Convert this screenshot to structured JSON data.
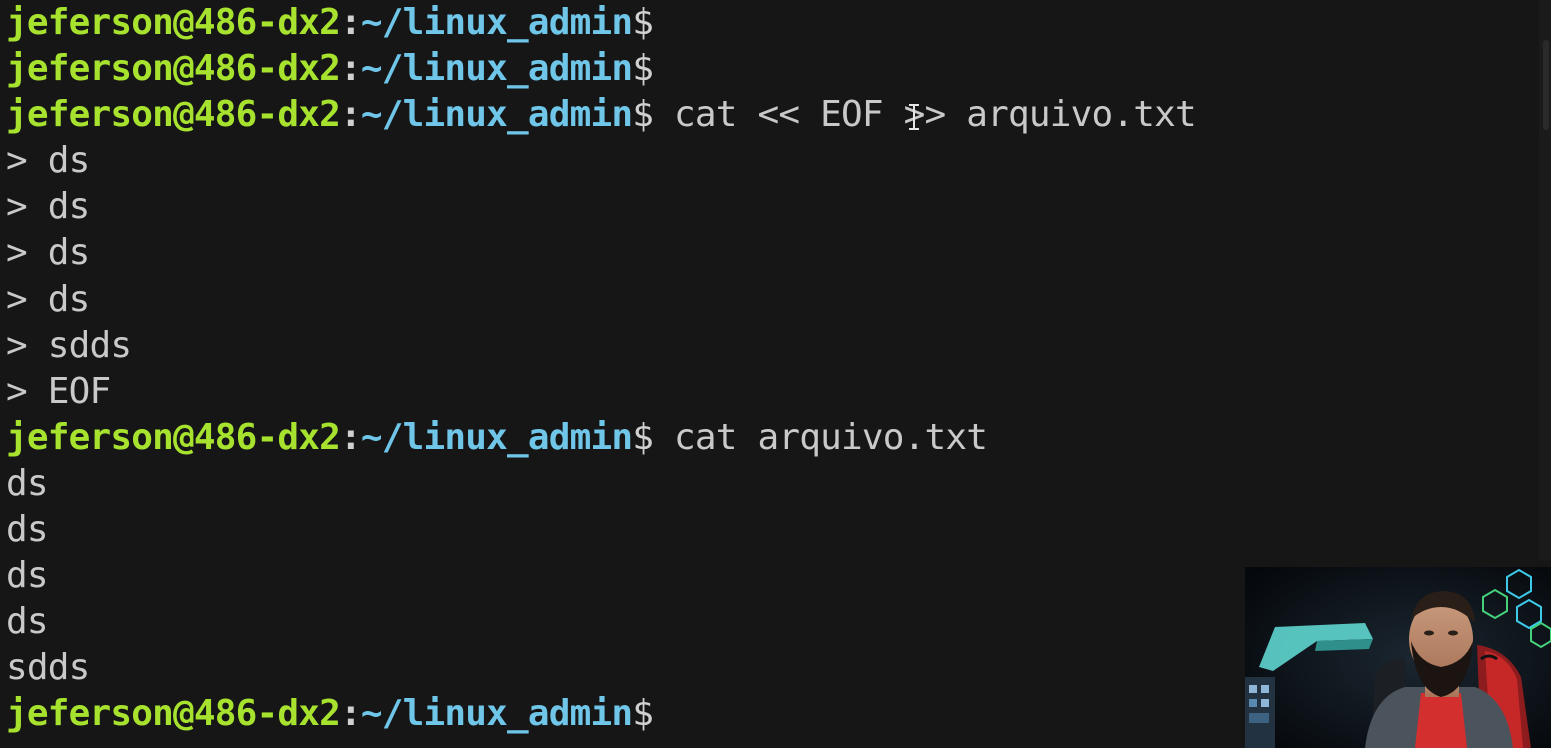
{
  "prompt": {
    "user_host": "jeferson@486-dx2",
    "colon": ":",
    "path": "~/linux_admin",
    "symbol": "$"
  },
  "lines": [
    {
      "type": "prompt",
      "cmd": ""
    },
    {
      "type": "prompt",
      "cmd": ""
    },
    {
      "type": "prompt",
      "cmd": " cat << EOF >> arquivo.txt"
    },
    {
      "type": "output",
      "text": "> ds"
    },
    {
      "type": "output",
      "text": "> ds"
    },
    {
      "type": "output",
      "text": "> ds"
    },
    {
      "type": "output",
      "text": "> ds"
    },
    {
      "type": "output",
      "text": "> sdds"
    },
    {
      "type": "output",
      "text": "> EOF"
    },
    {
      "type": "prompt",
      "cmd": " cat arquivo.txt"
    },
    {
      "type": "output",
      "text": "ds"
    },
    {
      "type": "output",
      "text": "ds"
    },
    {
      "type": "output",
      "text": "ds"
    },
    {
      "type": "output",
      "text": "ds"
    },
    {
      "type": "output",
      "text": "sdds"
    },
    {
      "type": "prompt",
      "cmd": ""
    }
  ],
  "colors": {
    "background": "#161616",
    "user_host": "#a6e22e",
    "path": "#6fc6e8",
    "text": "#c9c9c9"
  }
}
